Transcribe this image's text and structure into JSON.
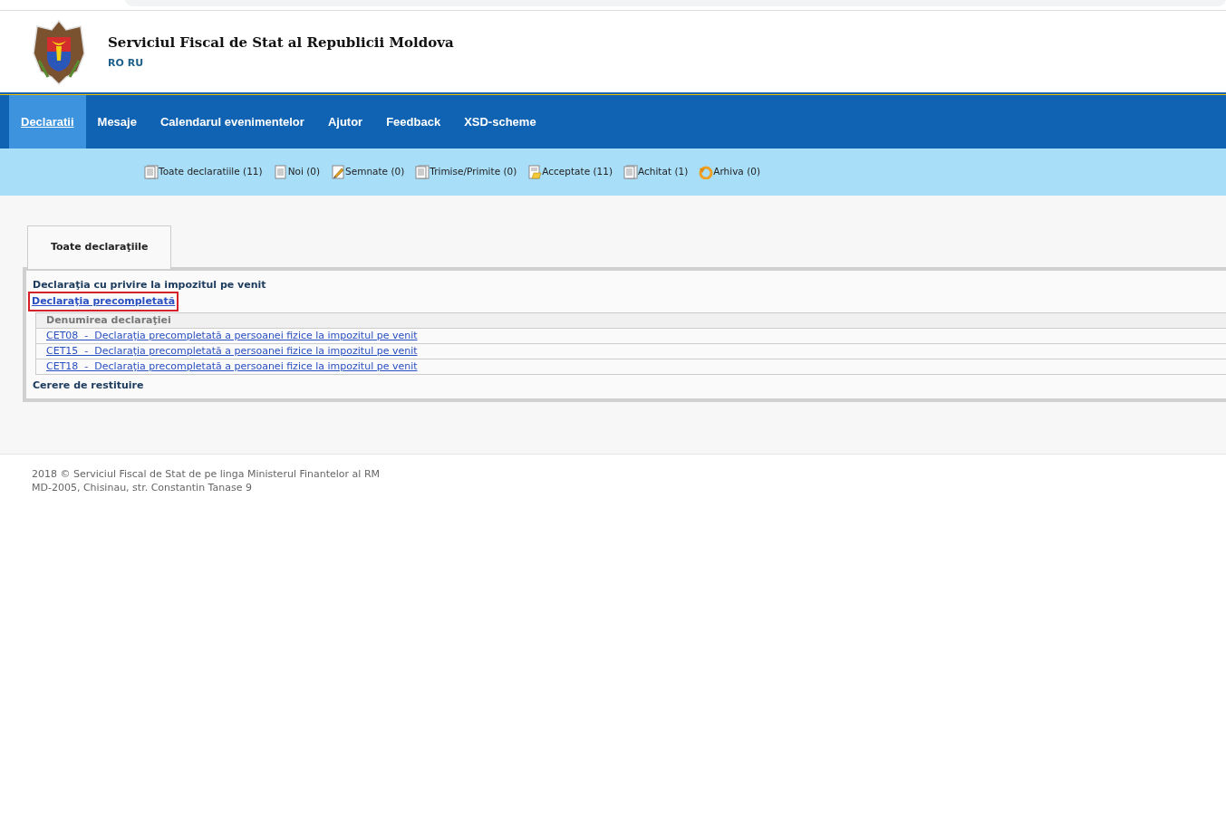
{
  "header": {
    "title": "Serviciul Fiscal de Stat al Republicii Moldova",
    "languages": [
      "RO",
      "RU"
    ]
  },
  "nav": [
    {
      "label": "Declaratii",
      "selected": true
    },
    {
      "label": "Mesaje",
      "selected": false
    },
    {
      "label": "Calendarul evenimentelor",
      "selected": false
    },
    {
      "label": "Ajutor",
      "selected": false
    },
    {
      "label": "Feedback",
      "selected": false
    },
    {
      "label": "XSD-scheme",
      "selected": false
    }
  ],
  "subnav": [
    {
      "kind": "pages",
      "label": "Toate declaratiile (11)"
    },
    {
      "kind": "page",
      "label": "Noi (0)"
    },
    {
      "kind": "signed",
      "label": "Semnate (0)"
    },
    {
      "kind": "pages",
      "label": "Trimise/Primite (0)"
    },
    {
      "kind": "accepted",
      "label": "Acceptate (11)"
    },
    {
      "kind": "pages",
      "label": "Achitat (1)"
    },
    {
      "kind": "archive",
      "label": "Arhiva (0)"
    }
  ],
  "tabs": [
    {
      "label": "Toate declaraţiile",
      "selected": true
    }
  ],
  "sections": [
    {
      "title": "Declaraţia cu privire la impozitul pe venit",
      "link": {
        "label": "Declaraţia precompletată",
        "highlighted": true
      },
      "table": {
        "columns": [
          "Denumirea declaraţiei"
        ],
        "rows": [
          {
            "label": "CET08  -  Declaraţia precompletată a persoanei fizice la impozitul pe venit"
          },
          {
            "label": "CET15  -  Declaraţia precompletată a persoanei fizice la impozitul pe venit"
          },
          {
            "label": "CET18  -  Declaraţia precompletată a persoanei fizice la impozitul pe venit"
          }
        ]
      }
    },
    {
      "title": "Cerere de restituire"
    }
  ],
  "footer": [
    "2018 © Serviciul Fiscal de Stat de pe linga Ministerul Finantelor al RM",
    "MD-2005, Chisinau, str. Constantin Tanase 9"
  ]
}
